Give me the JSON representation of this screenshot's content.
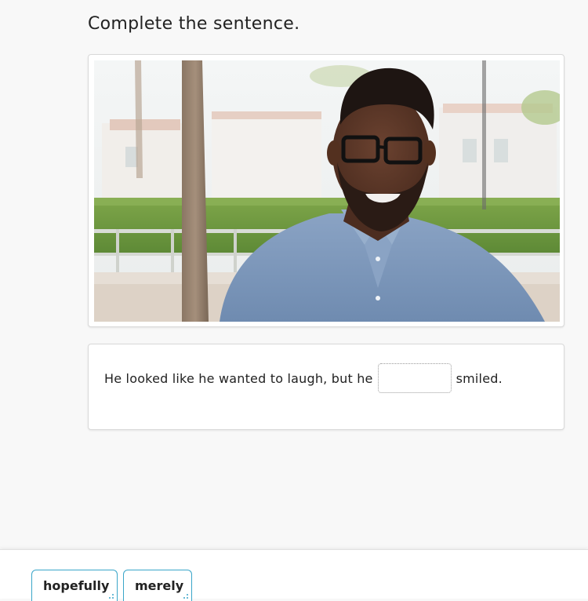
{
  "instruction": "Complete the sentence.",
  "sentence": {
    "before": "He looked like he wanted to laugh, but he",
    "after": "smiled."
  },
  "word_bank": [
    {
      "label": "hopefully"
    },
    {
      "label": "merely"
    }
  ],
  "colors": {
    "chip_border": "#3aa6c9",
    "background": "#f8f8f8"
  }
}
